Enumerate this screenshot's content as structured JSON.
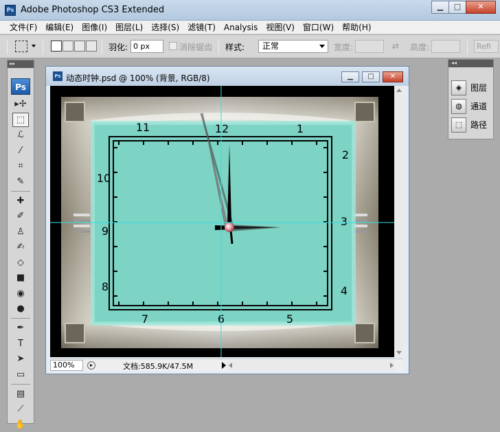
{
  "app": {
    "title": "Adobe Photoshop CS3 Extended",
    "icon_text": "Ps"
  },
  "window_controls": {
    "minimize": "▁",
    "maximize": "□",
    "close": "✕"
  },
  "menubar": {
    "items": [
      "文件(F)",
      "编辑(E)",
      "图像(I)",
      "图层(L)",
      "选择(S)",
      "滤镜(T)",
      "Analysis",
      "视图(V)",
      "窗口(W)",
      "帮助(H)"
    ]
  },
  "options_bar": {
    "feather_label": "羽化:",
    "feather_value": "0 px",
    "antialias_label": "消除锯齿",
    "style_label": "样式:",
    "style_value": "正常",
    "width_label": "宽度:",
    "height_label": "高度:",
    "refine_label": "Refi"
  },
  "toolbox": {
    "header": "▸▸",
    "logo": "Ps",
    "tools": [
      {
        "name": "move-tool-icon",
        "glyph": "▸✢"
      },
      {
        "name": "rect-marquee-tool-icon",
        "glyph": "⬚",
        "active": true
      },
      {
        "name": "lasso-tool-icon",
        "glyph": "ℒ"
      },
      {
        "name": "magic-wand-tool-icon",
        "glyph": "⁄"
      },
      {
        "name": "crop-tool-icon",
        "glyph": "⌗"
      },
      {
        "name": "slice-tool-icon",
        "glyph": "✎"
      },
      {
        "name": "healing-brush-tool-icon",
        "glyph": "✚"
      },
      {
        "name": "brush-tool-icon",
        "glyph": "✐"
      },
      {
        "name": "clone-stamp-tool-icon",
        "glyph": "♙"
      },
      {
        "name": "history-brush-tool-icon",
        "glyph": "✍"
      },
      {
        "name": "eraser-tool-icon",
        "glyph": "◇"
      },
      {
        "name": "gradient-tool-icon",
        "glyph": "■"
      },
      {
        "name": "blur-tool-icon",
        "glyph": "◉"
      },
      {
        "name": "dodge-tool-icon",
        "glyph": "●"
      },
      {
        "name": "pen-tool-icon",
        "glyph": "✒"
      },
      {
        "name": "type-tool-icon",
        "glyph": "T"
      },
      {
        "name": "path-selection-tool-icon",
        "glyph": "➤"
      },
      {
        "name": "shape-tool-icon",
        "glyph": "▭"
      },
      {
        "name": "notes-tool-icon",
        "glyph": "▤"
      },
      {
        "name": "eyedropper-tool-icon",
        "glyph": "⟋"
      },
      {
        "name": "hand-tool-icon",
        "glyph": "✋"
      }
    ]
  },
  "document": {
    "icon_text": "Ps",
    "title": "动态时钟.psd @ 100% (背景, RGB/8)",
    "zoom": "100%",
    "doc_size": "文档:585.9K/47.5M"
  },
  "clock": {
    "numbers": [
      "12",
      "1",
      "2",
      "3",
      "4",
      "5",
      "6",
      "7",
      "8",
      "9",
      "10",
      "11"
    ],
    "face_color": "#7dd3c4",
    "frame_color": "#9a9383",
    "guide_color": "#33e0e0"
  },
  "panel": {
    "header": "◂◂",
    "items": [
      {
        "name": "layers",
        "label": "图层",
        "icon": "layers-icon",
        "glyph": "◈"
      },
      {
        "name": "channels",
        "label": "通道",
        "icon": "channels-icon",
        "glyph": "◍"
      },
      {
        "name": "paths",
        "label": "路径",
        "icon": "paths-icon",
        "glyph": "⬚"
      }
    ]
  }
}
